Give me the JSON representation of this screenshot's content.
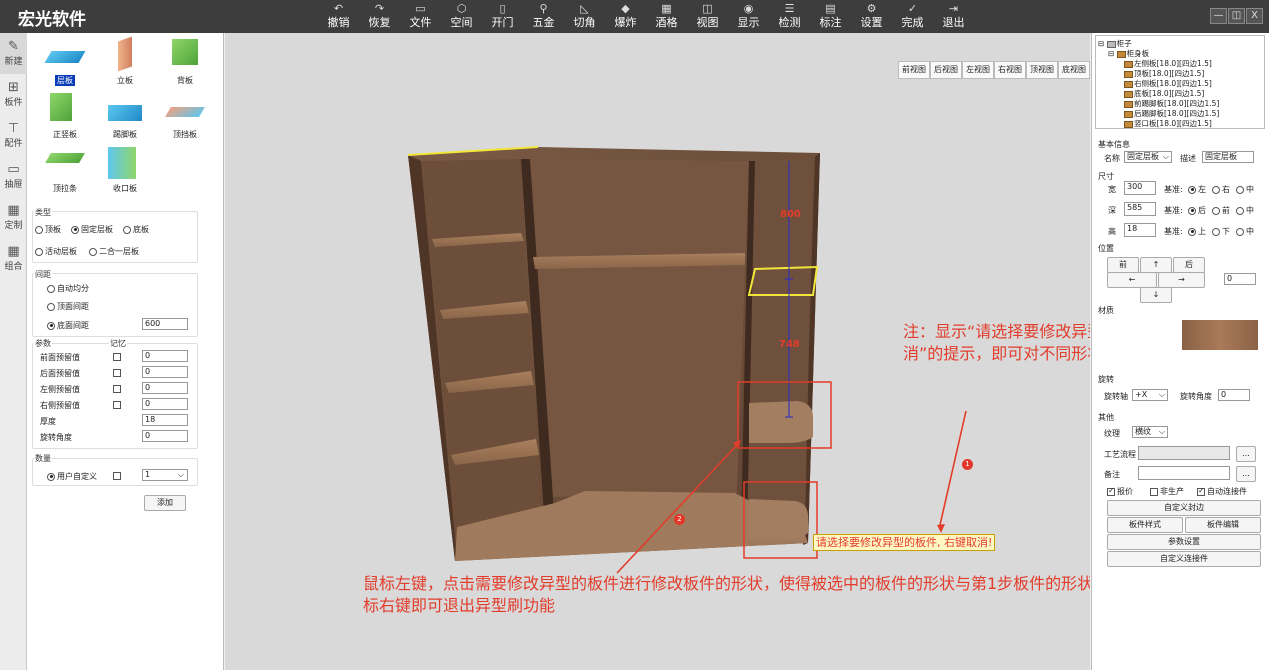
{
  "app": {
    "title": "宏光软件"
  },
  "toolbar": [
    {
      "label": "撤销",
      "icon": "undo-icon",
      "glyph": "↶"
    },
    {
      "label": "恢复",
      "icon": "redo-icon",
      "glyph": "↷"
    },
    {
      "label": "文件",
      "icon": "folder-icon",
      "glyph": "▭"
    },
    {
      "label": "空间",
      "icon": "cube-icon",
      "glyph": "⬡"
    },
    {
      "label": "开门",
      "icon": "door-icon",
      "glyph": "▯"
    },
    {
      "label": "五金",
      "icon": "hardware-icon",
      "glyph": "⚲"
    },
    {
      "label": "切角",
      "icon": "cut-corner-icon",
      "glyph": "◺"
    },
    {
      "label": "爆炸",
      "icon": "explode-icon",
      "glyph": "◆"
    },
    {
      "label": "酒格",
      "icon": "wine-grid-icon",
      "glyph": "▦"
    },
    {
      "label": "视图",
      "icon": "view-icon",
      "glyph": "◫"
    },
    {
      "label": "显示",
      "icon": "eye-icon",
      "glyph": "◉"
    },
    {
      "label": "检测",
      "icon": "check-list-icon",
      "glyph": "☰"
    },
    {
      "label": "标注",
      "icon": "annotation-icon",
      "glyph": "▤"
    },
    {
      "label": "设置",
      "icon": "gear-icon",
      "glyph": "⚙"
    },
    {
      "label": "完成",
      "icon": "done-icon",
      "glyph": "✓"
    },
    {
      "label": "退出",
      "icon": "exit-icon",
      "glyph": "⇥"
    }
  ],
  "window_controls": [
    "—",
    "◫",
    "X"
  ],
  "leftnav": [
    {
      "label": "新建",
      "icon": "edit-icon",
      "glyph": "✎",
      "active": true
    },
    {
      "label": "板件",
      "icon": "panel-icon",
      "glyph": "⊞"
    },
    {
      "label": "配件",
      "icon": "fitting-icon",
      "glyph": "⊤"
    },
    {
      "label": "抽屉",
      "icon": "drawer-icon",
      "glyph": "▭"
    },
    {
      "label": "定制",
      "icon": "custom-icon",
      "glyph": "▦"
    },
    {
      "label": "组合",
      "icon": "combine-icon",
      "glyph": "▦"
    }
  ],
  "boards": [
    {
      "label": "层板",
      "selected": true
    },
    {
      "label": "立板"
    },
    {
      "label": "背板"
    },
    {
      "label": "正竖板"
    },
    {
      "label": "踢脚板"
    },
    {
      "label": "顶挡板"
    },
    {
      "label": "顶拉条"
    },
    {
      "label": "收口板"
    }
  ],
  "type_group": {
    "title": "类型",
    "options": [
      {
        "label": "顶板",
        "checked": false
      },
      {
        "label": "固定层板",
        "checked": true
      },
      {
        "label": "底板",
        "checked": false
      },
      {
        "label": "活动层板",
        "checked": false
      },
      {
        "label": "二合一层板",
        "checked": false
      }
    ]
  },
  "spacing_group": {
    "title": "间距",
    "options": [
      {
        "label": "自动均分",
        "checked": false
      },
      {
        "label": "顶面间距",
        "checked": false
      },
      {
        "label": "底面间距",
        "checked": true,
        "value": "600"
      }
    ]
  },
  "params_group": {
    "title": "参数",
    "memory_label": "记忆",
    "rows": [
      {
        "label": "前面预留值",
        "value": "0",
        "check": true
      },
      {
        "label": "后面预留值",
        "value": "0",
        "check": true
      },
      {
        "label": "左侧预留值",
        "value": "0",
        "check": true
      },
      {
        "label": "右侧预留值",
        "value": "0",
        "check": true
      },
      {
        "label": "厚度",
        "value": "18",
        "check": false
      },
      {
        "label": "旋转角度",
        "value": "0",
        "check": false
      }
    ]
  },
  "quantity_group": {
    "title": "数量",
    "option": "用户自定义",
    "value": "1",
    "add_label": "添加"
  },
  "view_buttons": [
    "前视图",
    "后视图",
    "左视图",
    "右视图",
    "顶视图",
    "底视图"
  ],
  "dimensions": {
    "upper": "800",
    "lower": "748"
  },
  "hint_banner": "请选择要修改异型的板件, 右键取消!",
  "annotations": {
    "note": "注：显示“请选择要修改异型的板件，右键取消”的提示，即可对不同形状的板件进行异型刷",
    "instruction": "鼠标左键，点击需要修改异型的板件进行修改板件的形状，使得被选中的板件的形状与第1步板件的形状相同；完成后，点击鼠标右键即可退出异型刷功能",
    "marker1": "1",
    "marker2": "2"
  },
  "tree": {
    "root": "柜子",
    "child": "柜身板",
    "items": [
      "左侧板[18.0][四边1.5]",
      "顶板[18.0][四边1.5]",
      "右侧板[18.0][四边1.5]",
      "底板[18.0][四边1.5]",
      "前踢脚板[18.0][四边1.5]",
      "后踢脚板[18.0][四边1.5]",
      "竖口板[18.0][四边1.5]"
    ]
  },
  "props": {
    "basic_title": "基本信息",
    "name_label": "名称",
    "name_value": "固定层板",
    "desc_label": "描述",
    "desc_value": "固定层板",
    "size_title": "尺寸",
    "width_label": "宽",
    "width_value": "300",
    "depth_label": "深",
    "depth_value": "585",
    "height_label": "高",
    "height_value": "18",
    "base_label": "基准:",
    "width_base": [
      "左",
      "右",
      "中"
    ],
    "depth_base": [
      "后",
      "前",
      "中"
    ],
    "height_base": [
      "上",
      "下",
      "中"
    ],
    "pos_title": "位置",
    "pos_buttons": [
      "前",
      "↑",
      "后",
      "←",
      "→",
      "↓"
    ],
    "pos_value": "0",
    "material_title": "材质",
    "rotate_title": "旋转",
    "rotate_axis_label": "旋转轴",
    "rotate_axis_value": "+X",
    "rotate_angle_label": "旋转角度",
    "rotate_angle_value": "0",
    "other_title": "其他",
    "texture_label": "纹理",
    "texture_value": "横纹",
    "process_label": "工艺流程",
    "note_label": "备注",
    "ellipsis": "...",
    "checks": [
      {
        "label": "报价",
        "checked": true
      },
      {
        "label": "非生产",
        "checked": false
      },
      {
        "label": "自动连接件",
        "checked": true
      }
    ],
    "buttons": [
      "自定义封边",
      "板件样式",
      "板件编辑",
      "参数设置",
      "自定义连接件"
    ]
  },
  "colors": {
    "titlebar": "#3d3d3d",
    "accent_red": "#e23c2b",
    "wood": "#6b4a36",
    "highlight": "#f2e63a"
  }
}
